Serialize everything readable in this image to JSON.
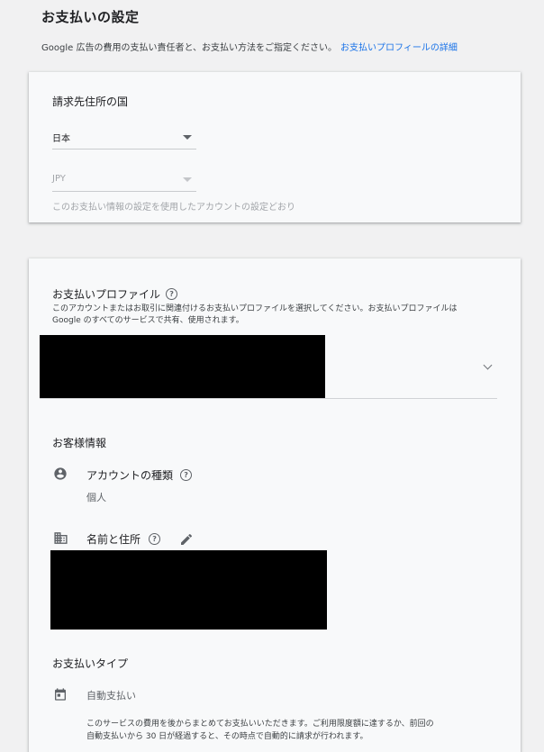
{
  "header": {
    "title": "お支払いの設定",
    "description": "Google 広告の費用の支払い責任者と、お支払い方法をご指定ください。",
    "details_link": "お支払いプロフィールの詳細"
  },
  "billing_country": {
    "heading": "請求先住所の国",
    "country_value": "日本",
    "currency_value": "JPY",
    "currency_note": "このお支払い情報の設定を使用したアカウントの設定どおり"
  },
  "payments_profile": {
    "heading": "お支払いプロファイル",
    "description_line1": "このアカウントまたはお取引に関連付けるお支払いプロファイルを選択してください。お支払いプロファイルは",
    "description_line2": "Google のすべてのサービスで共有、使用されます。",
    "help_icon_glyph": "?"
  },
  "customer_info": {
    "heading": "お客様情報",
    "account_type_label": "アカウントの種類",
    "account_type_value": "個人",
    "name_address_label": "名前と住所"
  },
  "payment_type": {
    "heading": "お支払いタイプ",
    "value": "自動支払い",
    "description_line1": "このサービスの費用を後からまとめてお支払いいただきます。ご利用限度額に達するか、前回の",
    "description_line2": "自動支払いから 30 日が経過すると、その時点で自動的に請求が行われます。"
  },
  "colors": {
    "link": "#1a73e8",
    "card_bg": "#f8f9fa",
    "page_bg": "#f1f1f2"
  }
}
